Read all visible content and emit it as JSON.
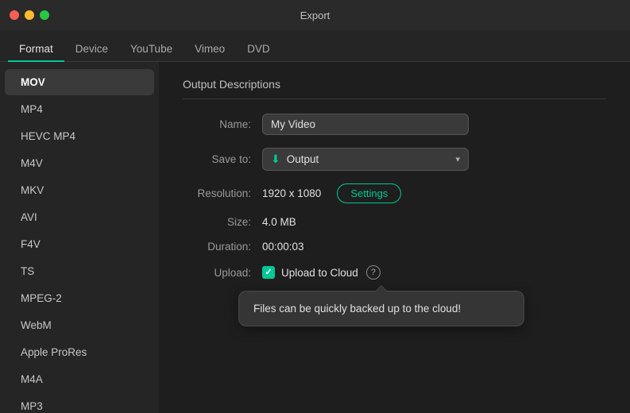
{
  "titleBar": {
    "title": "Export",
    "trafficLights": [
      "red",
      "yellow",
      "green"
    ]
  },
  "tabs": {
    "items": [
      {
        "id": "format",
        "label": "Format",
        "active": true
      },
      {
        "id": "device",
        "label": "Device",
        "active": false
      },
      {
        "id": "youtube",
        "label": "YouTube",
        "active": false
      },
      {
        "id": "vimeo",
        "label": "Vimeo",
        "active": false
      },
      {
        "id": "dvd",
        "label": "DVD",
        "active": false
      }
    ]
  },
  "sidebar": {
    "items": [
      {
        "id": "mov",
        "label": "MOV",
        "active": true
      },
      {
        "id": "mp4",
        "label": "MP4",
        "active": false
      },
      {
        "id": "hevc-mp4",
        "label": "HEVC MP4",
        "active": false
      },
      {
        "id": "m4v",
        "label": "M4V",
        "active": false
      },
      {
        "id": "mkv",
        "label": "MKV",
        "active": false
      },
      {
        "id": "avi",
        "label": "AVI",
        "active": false
      },
      {
        "id": "f4v",
        "label": "F4V",
        "active": false
      },
      {
        "id": "ts",
        "label": "TS",
        "active": false
      },
      {
        "id": "mpeg2",
        "label": "MPEG-2",
        "active": false
      },
      {
        "id": "webm",
        "label": "WebM",
        "active": false
      },
      {
        "id": "apple-prores",
        "label": "Apple ProRes",
        "active": false
      },
      {
        "id": "m4a",
        "label": "M4A",
        "active": false
      },
      {
        "id": "mp3",
        "label": "MP3",
        "active": false
      }
    ]
  },
  "content": {
    "outputDescTitle": "Output Descriptions",
    "fields": {
      "nameLabel": "Name:",
      "nameValue": "My Video",
      "saveToLabel": "Save to:",
      "saveToValue": "Output",
      "resolutionLabel": "Resolution:",
      "resolutionValue": "1920 x 1080",
      "sizeLabel": "Size:",
      "sizeValue": "4.0 MB",
      "durationLabel": "Duration:",
      "durationValue": "00:00:03",
      "uploadLabel": "Upload:",
      "uploadToCloudLabel": "Upload to Cloud"
    },
    "settingsButtonLabel": "Settings",
    "tooltipText": "Files can be quickly backed up to the cloud!",
    "helpIcon": "?",
    "checkmark": "✓"
  },
  "icons": {
    "download": "⬇",
    "chevronDown": "▾"
  }
}
